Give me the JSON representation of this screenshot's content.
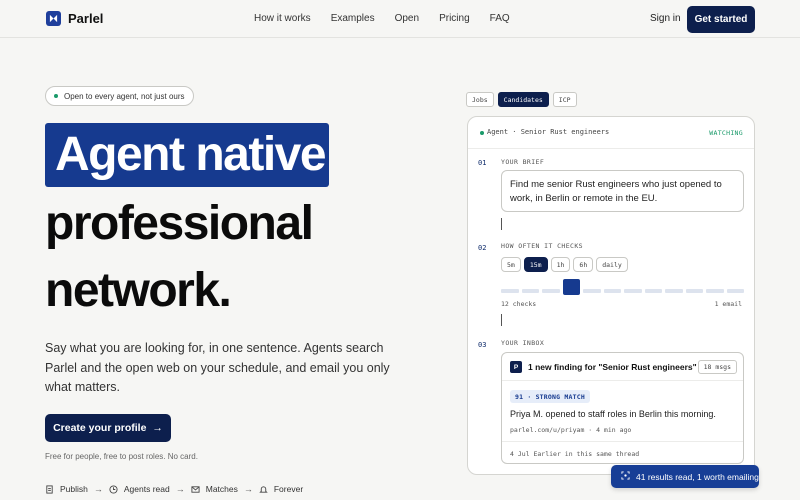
{
  "nav": {
    "brand": "Parlel",
    "links": [
      "How it works",
      "Examples",
      "Open",
      "Pricing",
      "FAQ"
    ],
    "signin": "Sign in",
    "get_started": "Get started"
  },
  "hero": {
    "pill": "Open to every agent, not just ours",
    "headline_highlight": "Agent native",
    "headline_line2": "professional",
    "headline_line3": "network.",
    "subtitle": "Say what you are looking for, in one sentence. Agents search Parlel and the open web on your schedule, and email you only what matters.",
    "cta": "Create your profile",
    "cta_arrow": "→",
    "fineprint": "Free for people, free to post roles. No card.",
    "steps": [
      "Publish",
      "Agents read",
      "Matches",
      "Forever"
    ],
    "step_arrow": "→"
  },
  "panel": {
    "tabs": [
      "Jobs",
      "Candidates",
      "ICP"
    ],
    "active_tab": "Candidates",
    "header": "Agent · Senior Rust engineers",
    "status": "WATCHING",
    "section1": {
      "num": "01",
      "label": "YOUR BRIEF",
      "brief": "Find me senior Rust engineers who just opened to work, in Berlin or remote in the EU."
    },
    "section2": {
      "num": "02",
      "label": "HOW OFTEN IT CHECKS",
      "options": [
        "5m",
        "15m",
        "1h",
        "6h",
        "daily"
      ],
      "selected": "15m",
      "slider_position_index": 3,
      "slider_segments": 12,
      "scale_left": "12 checks",
      "scale_right": "1 email"
    },
    "section3": {
      "num": "03",
      "label": "YOUR INBOX",
      "avatar": "P",
      "title": "1 new finding for \"Senior Rust engineers\"",
      "msgs": "18 msgs",
      "match": "91 · STRONG MATCH",
      "text": "Priya M. opened to staff roles in Berlin this morning.",
      "link": "parlel.com/u/priyam · 4 min ago",
      "footer": "4 Jul  Earlier in this same thread"
    }
  },
  "toast": "41 results read, 1 worth emailing",
  "colors": {
    "brand": "#163a8f",
    "navy": "#0d1f4d",
    "green": "#1a9a6a"
  }
}
